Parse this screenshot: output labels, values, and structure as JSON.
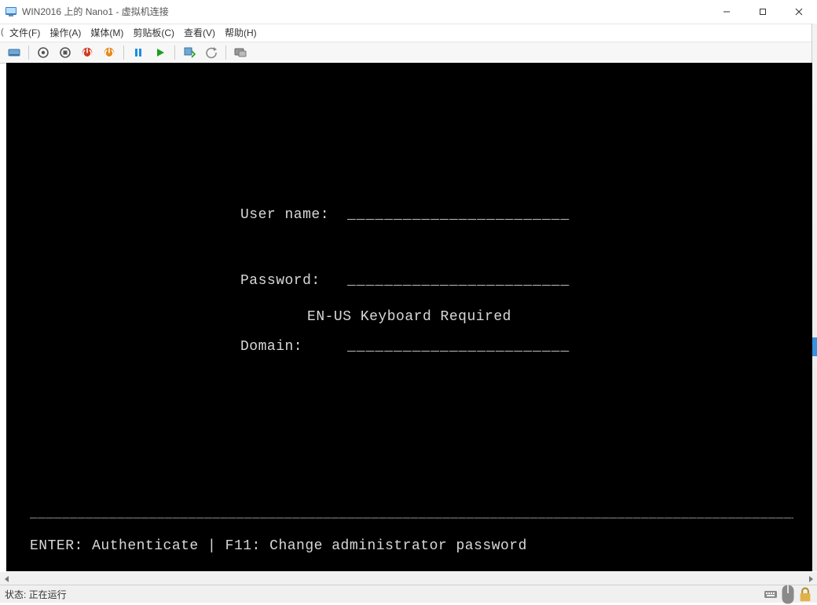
{
  "window": {
    "title": "WIN2016 上的 Nano1 - 虚拟机连接"
  },
  "menu": {
    "items": [
      {
        "label": "文件(F)"
      },
      {
        "label": "操作(A)"
      },
      {
        "label": "媒体(M)"
      },
      {
        "label": "剪贴板(C)"
      },
      {
        "label": "查看(V)"
      },
      {
        "label": "帮助(H)"
      }
    ]
  },
  "login": {
    "username_label": "User name:",
    "password_label": "Password:",
    "domain_label": "Domain:",
    "field_underscores": "________________________"
  },
  "keyboard_msg": "EN-US Keyboard Required",
  "separator_line": "─────────────────────────────────────────────────────────────────────────────────────────────────",
  "help_line": "ENTER: Authenticate | F11: Change administrator password",
  "status": {
    "label": "状态: 正在运行"
  },
  "left_edge_char": "("
}
